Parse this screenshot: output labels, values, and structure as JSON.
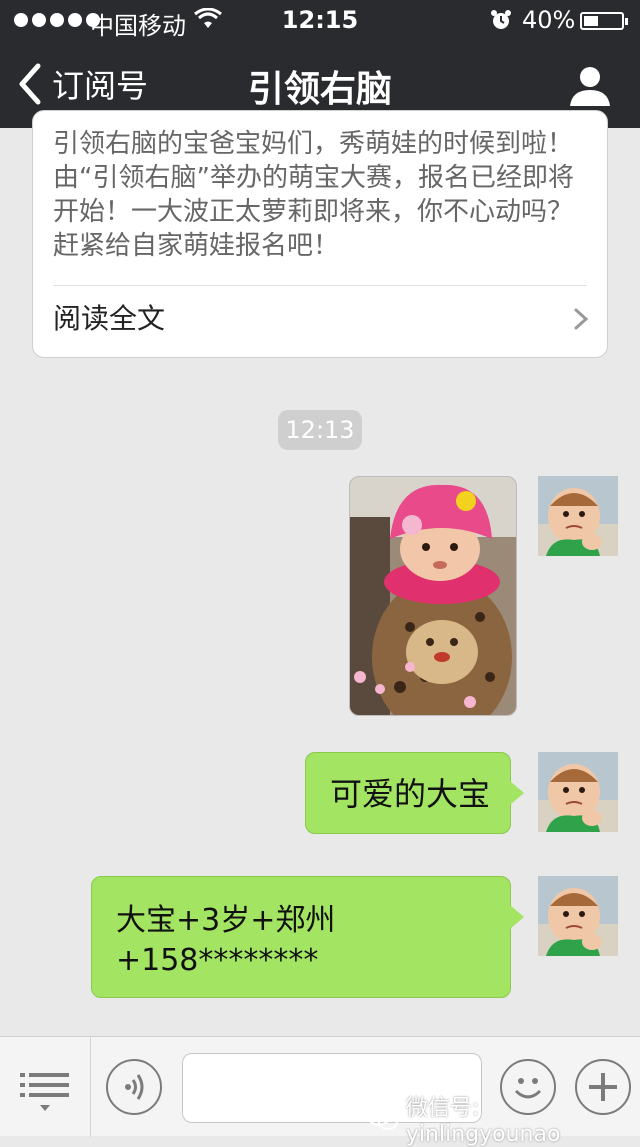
{
  "status_bar": {
    "carrier": "中国移动",
    "time": "12:15",
    "battery": "40%"
  },
  "nav": {
    "back_label": "订阅号",
    "title": "引领右脑"
  },
  "article": {
    "text": "引领右脑的宝爸宝妈们，秀萌娃的时候到啦！由“引领右脑”举办的萌宝大赛，报名已经即将开始！一大波正太萝莉即将来，你不心动吗？赶紧给自家萌娃报名吧！",
    "read_more": "阅读全文"
  },
  "timestamp": "12:13",
  "messages": [
    {
      "type": "image"
    },
    {
      "type": "text",
      "text": "可爱的大宝"
    },
    {
      "type": "text",
      "line1": "大宝+3岁+郑州",
      "line2": "+158********"
    }
  ],
  "watermark": "微信号: yinlingyounao",
  "colors": {
    "top_bar": "#2a2b2f",
    "chat_background": "#e9e9e9",
    "sent_bubble": "#a3e563"
  },
  "icons": [
    "signal-dots",
    "wifi-icon",
    "alarm-icon",
    "battery-icon",
    "chevron-left-icon",
    "profile-icon",
    "chevron-right-icon",
    "menu-list-icon",
    "voice-icon",
    "emoji-icon",
    "plus-icon",
    "wechat-icon"
  ]
}
